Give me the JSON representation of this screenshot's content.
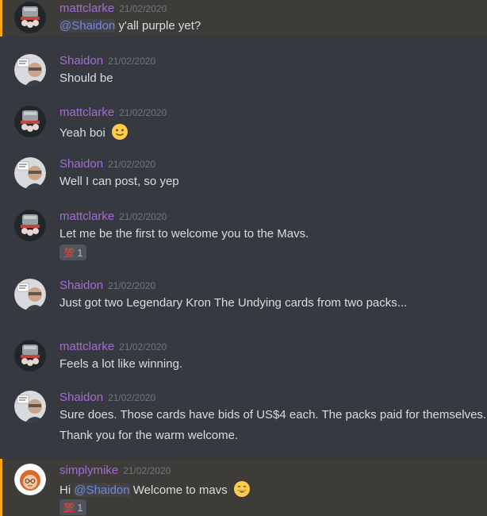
{
  "messages": [
    {
      "username": "mattclarke",
      "timestamp": "21/02/2020",
      "mention": "@Shaidon",
      "text": " y'all purple yet?"
    },
    {
      "username": "Shaidon",
      "timestamp": "21/02/2020",
      "text": "Should be"
    },
    {
      "username": "mattclarke",
      "timestamp": "21/02/2020",
      "text": "Yeah boi",
      "emoji": "slightly-smiling-face-icon"
    },
    {
      "username": "Shaidon",
      "timestamp": "21/02/2020",
      "text": "Well I can post, so yep"
    },
    {
      "username": "mattclarke",
      "timestamp": "21/02/2020",
      "text": "Let me be the first to welcome you to the Mavs.",
      "reaction": {
        "emoji": "💯",
        "count": "1"
      }
    },
    {
      "username": "Shaidon",
      "timestamp": "21/02/2020",
      "text": "Just got two Legendary Kron The Undying cards from two packs..."
    },
    {
      "username": "mattclarke",
      "timestamp": "21/02/2020",
      "text": "Feels a lot like winning."
    },
    {
      "username": "Shaidon",
      "timestamp": "21/02/2020",
      "text": "Sure does. Those cards have bids of US$4 each. The packs paid for themselves.",
      "text2": "Thank you for the warm welcome."
    },
    {
      "username": "simplymike",
      "timestamp": "21/02/2020",
      "prefix": "Hi ",
      "mention": "@Shaidon",
      "text": " Welcome to mavs",
      "emoji": "grinning-face-icon",
      "reaction": {
        "emoji": "💯",
        "count": "1"
      }
    }
  ],
  "colors": {
    "background": "#36393f",
    "username": "#a56ad9",
    "mention_highlight": "#faa61a",
    "mention_text": "#7289da"
  }
}
